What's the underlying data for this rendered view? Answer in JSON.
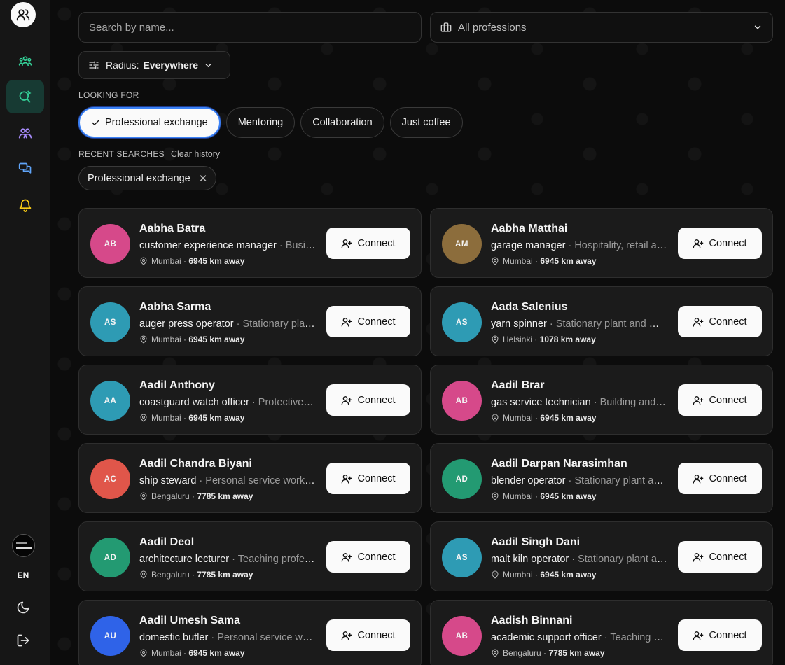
{
  "sidebar": {
    "logo_icon": "users-icon",
    "items": [
      {
        "icon": "community-icon",
        "color": "#34d399",
        "active": false
      },
      {
        "icon": "search-people-icon",
        "color": "#34d399",
        "active": true
      },
      {
        "icon": "people-icon",
        "color": "#a78bfa",
        "active": false
      },
      {
        "icon": "messages-icon",
        "color": "#60a5fa",
        "active": false
      },
      {
        "icon": "bell-icon",
        "color": "#facc15",
        "active": false
      }
    ],
    "language": "EN"
  },
  "filters": {
    "search_placeholder": "Search by name...",
    "profession_label": "All professions",
    "radius_label": "Radius:",
    "radius_value": "Everywhere"
  },
  "looking_for": {
    "label": "LOOKING FOR",
    "options": [
      {
        "label": "Professional exchange",
        "selected": true
      },
      {
        "label": "Mentoring",
        "selected": false
      },
      {
        "label": "Collaboration",
        "selected": false
      },
      {
        "label": "Just coffee",
        "selected": false
      }
    ]
  },
  "recent": {
    "label": "RECENT SEARCHES",
    "clear_label": "Clear history",
    "items": [
      "Professional exchange"
    ]
  },
  "connect_label": "Connect",
  "people": [
    {
      "initials": "AB",
      "color": "#d6498a",
      "name": "Aabha Batra",
      "role": "customer experience manager",
      "domain": "Business services",
      "city": "Mumbai",
      "distance": "6945 km away"
    },
    {
      "initials": "AM",
      "color": "#8c6d3c",
      "name": "Aabha Matthai",
      "role": "garage manager",
      "domain": "Hospitality, retail and other services",
      "city": "Mumbai",
      "distance": "6945 km away"
    },
    {
      "initials": "AS",
      "color": "#2e9bb4",
      "name": "Aabha Sarma",
      "role": "auger press operator",
      "domain": "Stationary plant and machine operators",
      "city": "Mumbai",
      "distance": "6945 km away"
    },
    {
      "initials": "AS",
      "color": "#2e9bb4",
      "name": "Aada Salenius",
      "role": "yarn spinner",
      "domain": "Stationary plant and machine operators",
      "city": "Helsinki",
      "distance": "1078 km away"
    },
    {
      "initials": "AA",
      "color": "#2e9bb4",
      "name": "Aadil Anthony",
      "role": "coastguard watch officer",
      "domain": "Protective services",
      "city": "Mumbai",
      "distance": "6945 km away"
    },
    {
      "initials": "AB",
      "color": "#d6498a",
      "name": "Aadil Brar",
      "role": "gas service technician",
      "domain": "Building and related trades",
      "city": "Mumbai",
      "distance": "6945 km away"
    },
    {
      "initials": "AC",
      "color": "#e0564a",
      "name": "Aadil Chandra Biyani",
      "role": "ship steward",
      "domain": "Personal service workers",
      "city": "Bengaluru",
      "distance": "7785 km away"
    },
    {
      "initials": "AD",
      "color": "#239a72",
      "name": "Aadil Darpan Narasimhan",
      "role": "blender operator",
      "domain": "Stationary plant and machine operators",
      "city": "Mumbai",
      "distance": "6945 km away"
    },
    {
      "initials": "AD",
      "color": "#239a72",
      "name": "Aadil Deol",
      "role": "architecture lecturer",
      "domain": "Teaching professionals",
      "city": "Bengaluru",
      "distance": "7785 km away"
    },
    {
      "initials": "AS",
      "color": "#2e9bb4",
      "name": "Aadil Singh Dani",
      "role": "malt kiln operator",
      "domain": "Stationary plant and machine operators",
      "city": "Mumbai",
      "distance": "6945 km away"
    },
    {
      "initials": "AU",
      "color": "#2f63e8",
      "name": "Aadil Umesh Sama",
      "role": "domestic butler",
      "domain": "Personal service workers",
      "city": "Mumbai",
      "distance": "6945 km away"
    },
    {
      "initials": "AB",
      "color": "#d6498a",
      "name": "Aadish Binnani",
      "role": "academic support officer",
      "domain": "Teaching professionals",
      "city": "Bengaluru",
      "distance": "7785 km away"
    }
  ]
}
